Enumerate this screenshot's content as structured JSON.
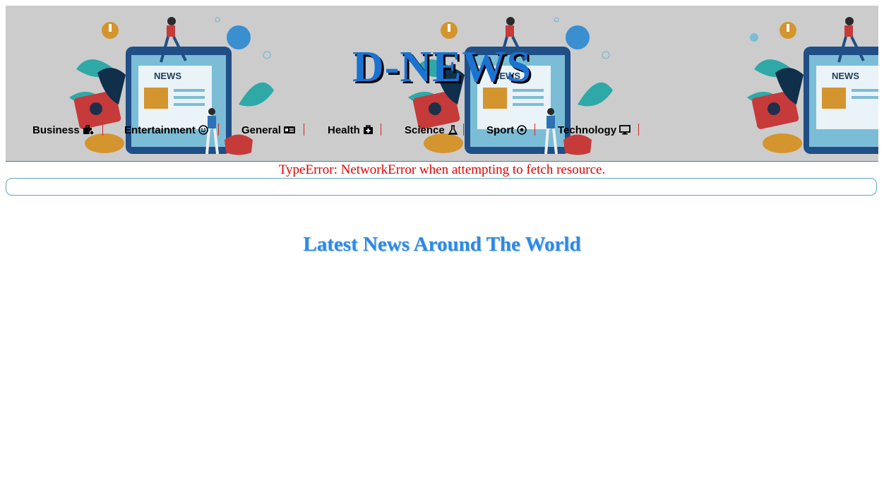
{
  "header": {
    "brand": "D-NEWS",
    "art_label": "NEWS"
  },
  "nav": {
    "items": [
      {
        "label": "Business",
        "icon": "briefcase-icon"
      },
      {
        "label": "Entertainment",
        "icon": "smile-icon"
      },
      {
        "label": "General",
        "icon": "id-card-icon"
      },
      {
        "label": "Health",
        "icon": "medkit-icon"
      },
      {
        "label": "Science",
        "icon": "flask-icon"
      },
      {
        "label": "Sport",
        "icon": "soccer-ball-icon"
      },
      {
        "label": "Technology",
        "icon": "monitor-icon"
      }
    ]
  },
  "status": {
    "error_message": "TypeError: NetworkError when attempting to fetch resource."
  },
  "search": {
    "value": "",
    "placeholder": ""
  },
  "main": {
    "headline": "Latest News Around The World"
  },
  "colors": {
    "brand": "#1a73d1",
    "error": "#e30000",
    "headline": "#2b8ae8",
    "header_bg": "#cccccc",
    "separator": "#d32424"
  }
}
